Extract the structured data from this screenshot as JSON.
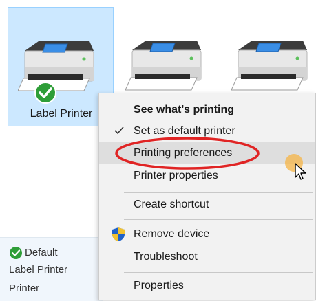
{
  "printers": [
    {
      "label": "Label Printer",
      "selected": true,
      "default": true
    },
    {
      "label": "",
      "selected": false,
      "default": false
    },
    {
      "label": "",
      "selected": false,
      "default": false
    }
  ],
  "icons": {
    "printer": "printer-icon",
    "default_check": "check-circle-icon",
    "menu_check": "checkmark-icon",
    "shield": "uac-shield-icon",
    "cursor": "mouse-pointer-icon"
  },
  "colors": {
    "selection_bg": "#cce8ff",
    "selection_border": "#99d1ff",
    "check_green": "#2e9e38",
    "annotation_red": "#e02424",
    "cursor_highlight": "#f5b446",
    "menu_bg": "#f2f2f2",
    "menu_hover": "#dedede"
  },
  "context_menu": {
    "items": [
      {
        "label": "See what's printing",
        "bold": true
      },
      {
        "label": "Set as default printer",
        "checked": true
      },
      {
        "label": "Printing preferences",
        "highlighted": true,
        "annotated": true
      },
      {
        "label": "Printer properties"
      },
      {
        "label": "Create shortcut"
      },
      {
        "label": "Remove device",
        "shield": true
      },
      {
        "label": "Troubleshoot"
      },
      {
        "label": "Properties"
      }
    ]
  },
  "details": {
    "status": "Default",
    "name": "Label Printer",
    "category": "Printer"
  }
}
